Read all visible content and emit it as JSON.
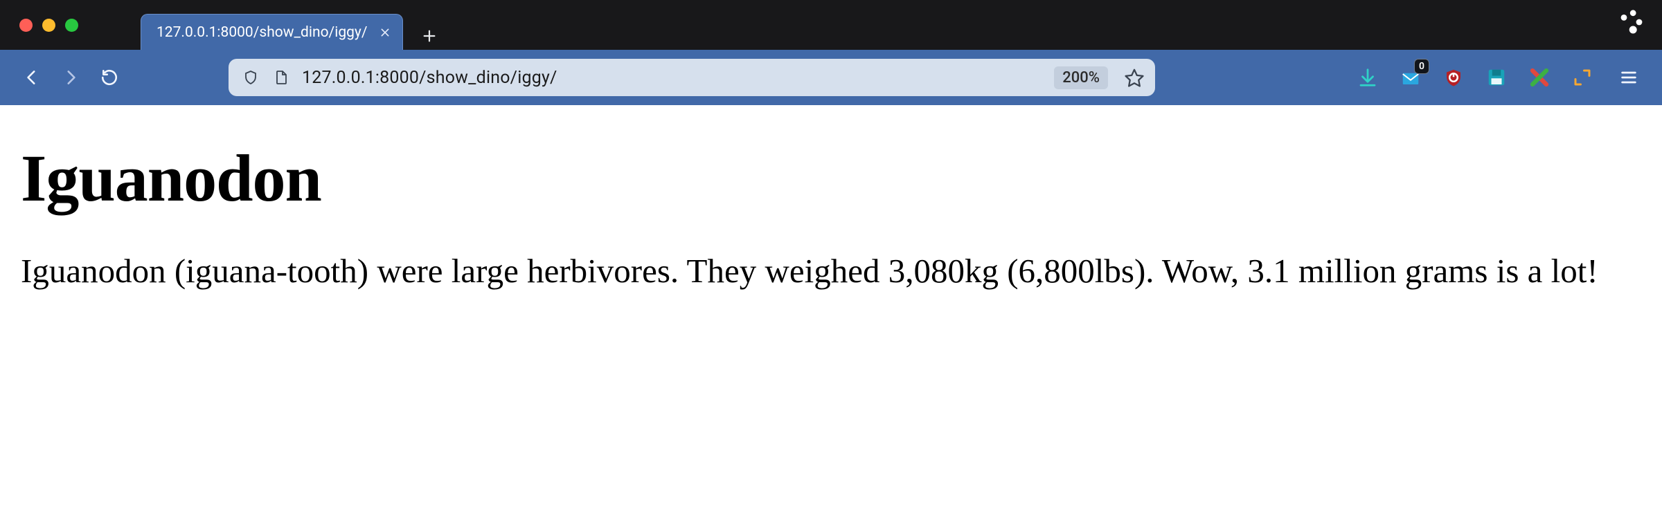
{
  "window": {
    "tab_title": "127.0.0.1:8000/show_dino/iggy/"
  },
  "toolbar": {
    "url": "127.0.0.1:8000/show_dino/iggy/",
    "zoom_label": "200%",
    "mail_badge": "0"
  },
  "content": {
    "heading": "Iguanodon",
    "paragraph": "Iguanodon (iguana-tooth) were large herbivores. They weighed 3,080kg (6,800lbs). Wow, 3.1 million grams is a lot!"
  }
}
